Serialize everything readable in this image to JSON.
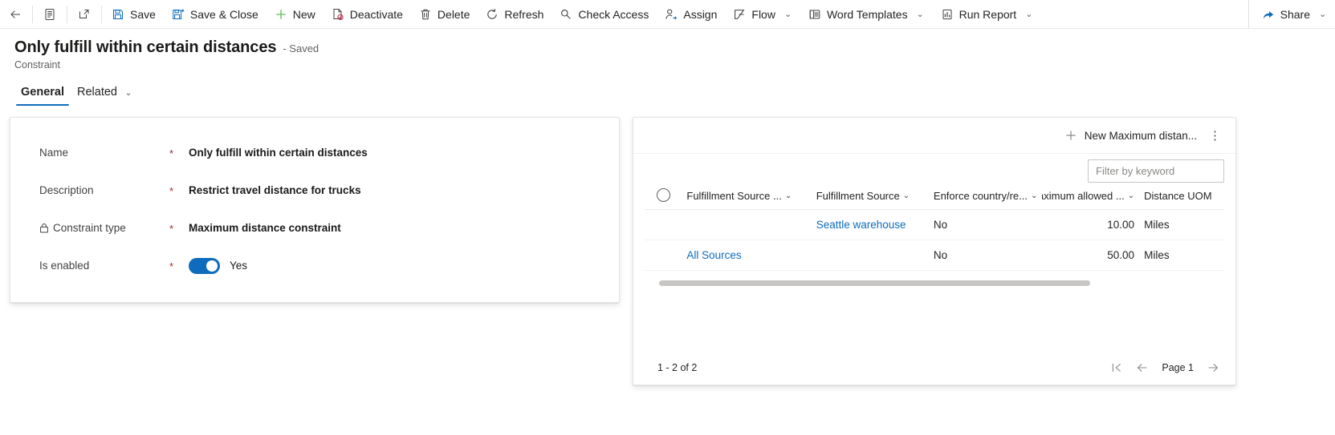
{
  "commandbar": {
    "back_label": "Back",
    "form_selector_label": "Form selector",
    "popout_label": "Open in new window",
    "items": [
      {
        "label": "Save",
        "icon": "save-icon"
      },
      {
        "label": "Save & Close",
        "icon": "save-close-icon"
      },
      {
        "label": "New",
        "icon": "plus-icon"
      },
      {
        "label": "Deactivate",
        "icon": "deactivate-icon"
      },
      {
        "label": "Delete",
        "icon": "trash-icon"
      },
      {
        "label": "Refresh",
        "icon": "refresh-icon"
      },
      {
        "label": "Check Access",
        "icon": "key-icon"
      },
      {
        "label": "Assign",
        "icon": "assign-icon"
      },
      {
        "label": "Flow",
        "icon": "flow-icon",
        "chevron": "⌄"
      },
      {
        "label": "Word Templates",
        "icon": "word-template-icon",
        "chevron": "⌄"
      },
      {
        "label": "Run Report",
        "icon": "report-icon",
        "chevron": "⌄"
      }
    ],
    "share": {
      "label": "Share",
      "icon": "share-icon",
      "chevron": "⌄"
    }
  },
  "record": {
    "title": "Only fulfill within certain distances",
    "saved_status": "- Saved",
    "entity": "Constraint"
  },
  "tabs": [
    {
      "label": "General",
      "active": true
    },
    {
      "label": "Related",
      "active": false,
      "chevron": "⌄"
    }
  ],
  "form": {
    "fields": [
      {
        "label": "Name",
        "required": "*",
        "value": "Only fulfill within certain distances",
        "locked": false
      },
      {
        "label": "Description",
        "required": "*",
        "value": "Restrict travel distance for trucks",
        "locked": false
      },
      {
        "label": "Constraint type",
        "required": "*",
        "value": "Maximum distance constraint",
        "locked": true
      },
      {
        "label": "Is enabled",
        "required": "*",
        "value": "Yes",
        "toggle": true,
        "toggle_on": true
      }
    ]
  },
  "subgrid": {
    "new_button_label": "New Maximum distan...",
    "new_button_icon": "plus-icon",
    "more_commands_label": "⋮",
    "filter_placeholder": "Filter by keyword",
    "select_all_label": "Select all rows",
    "columns": [
      {
        "label": "Fulfillment Source ...",
        "chevron": "⌄",
        "align": "left"
      },
      {
        "label": "Fulfillment Source",
        "chevron": "⌄",
        "align": "left"
      },
      {
        "label": "Enforce country/re...",
        "chevron": "⌄",
        "align": "left"
      },
      {
        "label": "Maximum allowed ...",
        "chevron": "⌄",
        "align": "right"
      },
      {
        "label": "Distance UOM",
        "chevron": "",
        "align": "left"
      }
    ],
    "rows": [
      {
        "c0": "",
        "c1": "Seattle warehouse",
        "c1_link": true,
        "c2": "No",
        "c3": "10.00",
        "c4": "Miles"
      },
      {
        "c0": "All Sources",
        "c0_link": true,
        "c1": "",
        "c2": "No",
        "c3": "50.00",
        "c4": "Miles"
      }
    ],
    "footer": {
      "count_label": "1 - 2 of 2",
      "page_label": "Page 1",
      "first_page_icon": "first-page-icon",
      "prev_page_icon": "previous-page-icon",
      "next_page_icon": "next-page-icon"
    }
  },
  "colors": {
    "accent": "#0f6cbd",
    "link": "#0f6cbd",
    "required": "#a4262c",
    "text": "#242424"
  }
}
